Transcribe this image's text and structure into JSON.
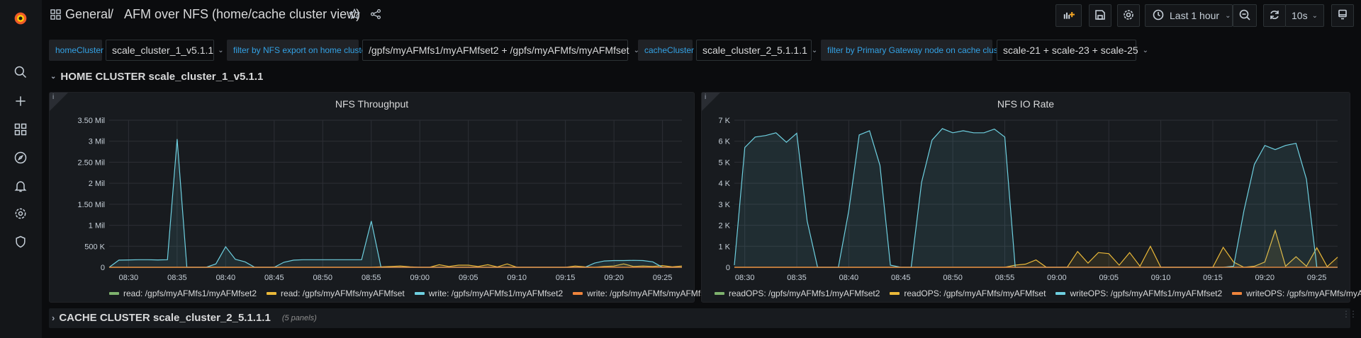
{
  "sidebar": {
    "items": [
      {
        "icon": "grafana-logo-icon"
      },
      {
        "icon": "search-icon"
      },
      {
        "icon": "plus-icon"
      },
      {
        "icon": "dashboards-icon"
      },
      {
        "icon": "explore-compass-icon"
      },
      {
        "icon": "alerting-bell-icon"
      },
      {
        "icon": "configuration-gear-icon"
      },
      {
        "icon": "server-admin-shield-icon"
      }
    ]
  },
  "header": {
    "folder": "General",
    "separator": "/",
    "title": "AFM over NFS (home/cache cluster view)"
  },
  "toolbar": {
    "time_range": "Last 1 hour",
    "refresh_interval": "10s"
  },
  "variables": [
    {
      "label": "homeCluster",
      "value": "scale_cluster_1_v5.1.1"
    },
    {
      "label": "filter by NFS export on home cluster",
      "value": "/gpfs/myAFMfs1/myAFMfset2 + /gpfs/myAFMfs/myAFMfset"
    },
    {
      "label": "cacheCluster",
      "value": "scale_cluster_2_5.1.1.1"
    },
    {
      "label": "filter by Primary Gateway node on cache cluster",
      "value": "scale-21 + scale-23 + scale-25"
    }
  ],
  "rows": {
    "home": {
      "title": "HOME CLUSTER scale_cluster_1_v5.1.1",
      "collapsed": false
    },
    "cache": {
      "title": "CACHE CLUSTER scale_cluster_2_5.1.1.1",
      "panels": "(5 panels)",
      "collapsed": true
    }
  },
  "colors": {
    "green": "#7eb26d",
    "yellow": "#eab839",
    "cyan": "#6ed0e0",
    "orange": "#ef843c",
    "accent": "#33a2e5"
  },
  "chart_data": [
    {
      "type": "line",
      "title": "NFS Throughput",
      "xlim": [
        "08:28",
        "09:27"
      ],
      "ylim": [
        0,
        3500000
      ],
      "yticks": [
        {
          "v": 0,
          "label": "0"
        },
        {
          "v": 500000,
          "label": "500 K"
        },
        {
          "v": 1000000,
          "label": "1 Mil"
        },
        {
          "v": 1500000,
          "label": "1.50 Mil"
        },
        {
          "v": 2000000,
          "label": "2 Mil"
        },
        {
          "v": 2500000,
          "label": "2.50 Mil"
        },
        {
          "v": 3000000,
          "label": "3 Mil"
        },
        {
          "v": 3500000,
          "label": "3.50 Mil"
        }
      ],
      "xticks": [
        "08:30",
        "08:35",
        "08:40",
        "08:45",
        "08:50",
        "08:55",
        "09:00",
        "09:05",
        "09:10",
        "09:15",
        "09:20",
        "09:25"
      ],
      "grid": true,
      "legend": "bottom",
      "x": [
        "08:28",
        "08:29",
        "08:30",
        "08:31",
        "08:32",
        "08:33",
        "08:34",
        "08:35",
        "08:36",
        "08:37",
        "08:38",
        "08:39",
        "08:40",
        "08:41",
        "08:42",
        "08:43",
        "08:44",
        "08:45",
        "08:46",
        "08:47",
        "08:48",
        "08:49",
        "08:50",
        "08:51",
        "08:52",
        "08:53",
        "08:54",
        "08:55",
        "08:56",
        "08:57",
        "08:58",
        "08:59",
        "09:00",
        "09:01",
        "09:02",
        "09:03",
        "09:04",
        "09:05",
        "09:06",
        "09:07",
        "09:08",
        "09:09",
        "09:10",
        "09:11",
        "09:12",
        "09:13",
        "09:14",
        "09:15",
        "09:16",
        "09:17",
        "09:18",
        "09:19",
        "09:20",
        "09:21",
        "09:22",
        "09:23",
        "09:24",
        "09:25",
        "09:26",
        "09:27"
      ],
      "series": [
        {
          "name": "read: /gpfs/myAFMfs1/myAFMfset2",
          "color": "#7eb26d",
          "values": [
            0,
            0,
            0,
            0,
            0,
            0,
            0,
            0,
            0,
            0,
            0,
            0,
            0,
            0,
            0,
            0,
            0,
            0,
            0,
            0,
            0,
            0,
            0,
            0,
            0,
            0,
            0,
            0,
            0,
            0,
            0,
            0,
            0,
            0,
            0,
            0,
            0,
            0,
            0,
            0,
            0,
            0,
            0,
            0,
            0,
            0,
            0,
            0,
            0,
            0,
            0,
            0,
            0,
            0,
            0,
            0,
            0,
            0,
            0,
            0
          ]
        },
        {
          "name": "read: /gpfs/myAFMfs/myAFMfset",
          "color": "#eab839",
          "values": [
            0,
            0,
            0,
            0,
            0,
            0,
            0,
            0,
            0,
            0,
            0,
            0,
            0,
            0,
            0,
            0,
            0,
            0,
            0,
            0,
            0,
            0,
            0,
            0,
            0,
            0,
            0,
            0,
            10000,
            20000,
            30000,
            10000,
            0,
            0,
            60000,
            20000,
            50000,
            50000,
            20000,
            60000,
            10000,
            80000,
            0,
            0,
            0,
            0,
            0,
            0,
            30000,
            10000,
            0,
            20000,
            30000,
            80000,
            20000,
            30000,
            20000,
            40000,
            10000,
            30000
          ]
        },
        {
          "name": "write: /gpfs/myAFMfs1/myAFMfset2",
          "color": "#6ed0e0",
          "values": [
            0,
            170000,
            175000,
            180000,
            180000,
            175000,
            180000,
            3050000,
            0,
            0,
            0,
            80000,
            490000,
            190000,
            130000,
            0,
            0,
            0,
            120000,
            170000,
            180000,
            180000,
            180000,
            180000,
            180000,
            180000,
            180000,
            1100000,
            0,
            0,
            0,
            0,
            0,
            0,
            0,
            0,
            0,
            0,
            0,
            0,
            0,
            0,
            0,
            0,
            0,
            0,
            0,
            0,
            0,
            0,
            100000,
            150000,
            160000,
            160000,
            165000,
            160000,
            130000,
            0,
            0,
            0
          ]
        },
        {
          "name": "write: /gpfs/myAFMfs/myAFMfset",
          "color": "#ef843c",
          "values": [
            0,
            0,
            0,
            0,
            0,
            0,
            0,
            0,
            0,
            0,
            0,
            0,
            0,
            0,
            0,
            0,
            0,
            0,
            0,
            0,
            0,
            0,
            0,
            0,
            0,
            0,
            0,
            0,
            0,
            0,
            0,
            0,
            0,
            0,
            0,
            0,
            0,
            0,
            0,
            0,
            0,
            0,
            0,
            0,
            0,
            0,
            0,
            0,
            0,
            0,
            0,
            0,
            0,
            0,
            0,
            0,
            0,
            0,
            0,
            0
          ]
        }
      ]
    },
    {
      "type": "line",
      "title": "NFS IO Rate",
      "xlim": [
        "08:29",
        "09:27"
      ],
      "ylim": [
        0,
        7000
      ],
      "yticks": [
        {
          "v": 0,
          "label": "0"
        },
        {
          "v": 1000,
          "label": "1 K"
        },
        {
          "v": 2000,
          "label": "2 K"
        },
        {
          "v": 3000,
          "label": "3 K"
        },
        {
          "v": 4000,
          "label": "4 K"
        },
        {
          "v": 5000,
          "label": "5 K"
        },
        {
          "v": 6000,
          "label": "6 K"
        },
        {
          "v": 7000,
          "label": "7 K"
        }
      ],
      "xticks": [
        "08:30",
        "08:35",
        "08:40",
        "08:45",
        "08:50",
        "08:55",
        "09:00",
        "09:05",
        "09:10",
        "09:15",
        "09:20",
        "09:25"
      ],
      "grid": true,
      "legend": "bottom",
      "x": [
        "08:29",
        "08:30",
        "08:31",
        "08:32",
        "08:33",
        "08:34",
        "08:35",
        "08:36",
        "08:37",
        "08:38",
        "08:39",
        "08:40",
        "08:41",
        "08:42",
        "08:43",
        "08:44",
        "08:45",
        "08:46",
        "08:47",
        "08:48",
        "08:49",
        "08:50",
        "08:51",
        "08:52",
        "08:53",
        "08:54",
        "08:55",
        "08:56",
        "08:57",
        "08:58",
        "08:59",
        "09:00",
        "09:01",
        "09:02",
        "09:03",
        "09:04",
        "09:05",
        "09:06",
        "09:07",
        "09:08",
        "09:09",
        "09:10",
        "09:11",
        "09:12",
        "09:13",
        "09:14",
        "09:15",
        "09:16",
        "09:17",
        "09:18",
        "09:19",
        "09:20",
        "09:21",
        "09:22",
        "09:23",
        "09:24",
        "09:25",
        "09:26",
        "09:27"
      ],
      "series": [
        {
          "name": "readOPS: /gpfs/myAFMfs1/myAFMfset2",
          "color": "#7eb26d",
          "values": [
            0,
            0,
            0,
            0,
            0,
            0,
            0,
            0,
            0,
            0,
            0,
            0,
            0,
            0,
            0,
            0,
            0,
            0,
            0,
            0,
            0,
            0,
            0,
            0,
            0,
            0,
            0,
            0,
            0,
            0,
            0,
            0,
            0,
            0,
            0,
            0,
            0,
            0,
            0,
            0,
            0,
            0,
            0,
            0,
            0,
            0,
            0,
            0,
            0,
            0,
            0,
            0,
            0,
            0,
            0,
            0,
            0,
            0,
            0
          ]
        },
        {
          "name": "readOPS: /gpfs/myAFMfs/myAFMfset",
          "color": "#eab839",
          "values": [
            0,
            0,
            0,
            0,
            0,
            0,
            0,
            0,
            0,
            0,
            0,
            0,
            0,
            0,
            0,
            0,
            0,
            0,
            0,
            0,
            0,
            0,
            0,
            0,
            0,
            0,
            0,
            100,
            150,
            350,
            0,
            0,
            0,
            750,
            200,
            700,
            650,
            100,
            700,
            50,
            1000,
            0,
            0,
            0,
            0,
            0,
            0,
            950,
            250,
            0,
            50,
            250,
            1750,
            50,
            500,
            50,
            930,
            30,
            480
          ]
        },
        {
          "name": "writeOPS: /gpfs/myAFMfs1/myAFMfset2",
          "color": "#6ed0e0",
          "values": [
            100,
            5700,
            6200,
            6270,
            6400,
            5950,
            6380,
            2200,
            0,
            0,
            0,
            2700,
            6300,
            6500,
            4850,
            100,
            0,
            0,
            4050,
            6050,
            6600,
            6400,
            6500,
            6400,
            6400,
            6580,
            6200,
            0,
            0,
            0,
            0,
            0,
            0,
            0,
            0,
            0,
            0,
            0,
            0,
            0,
            0,
            0,
            0,
            0,
            0,
            0,
            0,
            0,
            50,
            2700,
            4900,
            5800,
            5600,
            5800,
            5900,
            4200,
            0,
            0,
            0
          ]
        },
        {
          "name": "writeOPS: /gpfs/myAFMfs/myAFMfset",
          "color": "#ef843c",
          "values": [
            0,
            0,
            0,
            0,
            0,
            0,
            0,
            0,
            0,
            0,
            0,
            0,
            0,
            0,
            0,
            0,
            0,
            0,
            0,
            0,
            0,
            0,
            0,
            0,
            0,
            0,
            0,
            0,
            0,
            0,
            0,
            0,
            0,
            0,
            0,
            0,
            0,
            0,
            0,
            0,
            0,
            0,
            0,
            0,
            0,
            0,
            0,
            0,
            0,
            0,
            0,
            0,
            0,
            0,
            0,
            0,
            0,
            0,
            0
          ]
        }
      ]
    }
  ]
}
